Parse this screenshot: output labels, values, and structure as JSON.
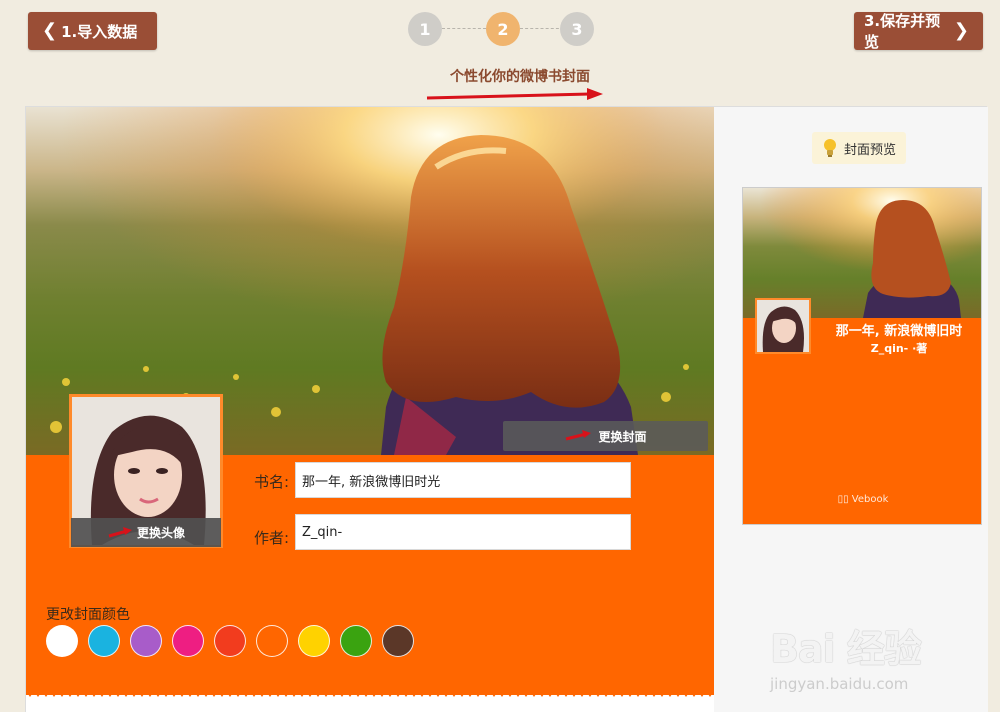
{
  "nav": {
    "prev_label": "1.导入数据",
    "next_label": "3.保存并预览",
    "steps": [
      "1",
      "2",
      "3"
    ],
    "active_step": 2
  },
  "subtitle": "个性化你的微博书封面",
  "editor": {
    "change_cover_label": "更换封面",
    "change_avatar_label": "更换头像",
    "title_label": "书名:",
    "title_value": "那一年, 新浪微博旧时光",
    "author_label": "作者:",
    "author_value": "Z_qin-",
    "color_label": "更改封面颜色",
    "colors": [
      "#ffffff",
      "#1ab3e0",
      "#a85cc9",
      "#ee1e82",
      "#f23c1e",
      "#ff6600",
      "#ffd200",
      "#3aa310",
      "#5b3728"
    ],
    "cover_color": "#ff6600"
  },
  "preview": {
    "tag_label": "封面预览",
    "title": "那一年, 新浪微博旧时",
    "author": "Z_qin- ·著",
    "brand": "Vebook"
  },
  "watermark": {
    "main": "Bai 经验",
    "url": "jingyan.baidu.com"
  },
  "icons": {
    "prev": "chevron-left-icon",
    "next": "chevron-right-icon",
    "tip": "lightbulb-icon",
    "brand": "book-icon"
  },
  "accent_color": "#9a4e36"
}
